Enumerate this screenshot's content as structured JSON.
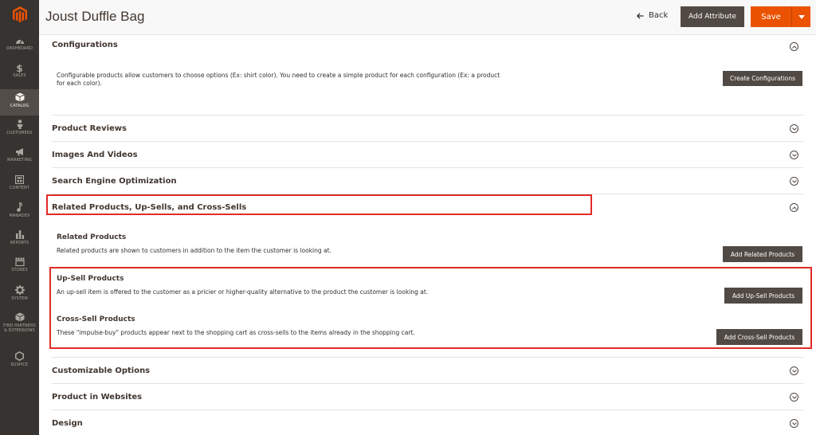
{
  "header": {
    "title": "Joust Duffle Bag",
    "back_label": "Back",
    "add_attribute_label": "Add Attribute",
    "save_label": "Save"
  },
  "sidebar": {
    "items": [
      {
        "label": "DASHBOARD",
        "icon": "dashboard-icon"
      },
      {
        "label": "SALES",
        "icon": "dollar-icon"
      },
      {
        "label": "CATALOG",
        "icon": "cube-icon"
      },
      {
        "label": "CUSTOMERS",
        "icon": "person-icon"
      },
      {
        "label": "MARKETING",
        "icon": "megaphone-icon"
      },
      {
        "label": "CONTENT",
        "icon": "content-icon"
      },
      {
        "label": "MANADEV",
        "icon": "manadev-icon"
      },
      {
        "label": "REPORTS",
        "icon": "bar-chart-icon"
      },
      {
        "label": "STORES",
        "icon": "store-icon"
      },
      {
        "label": "SYSTEM",
        "icon": "gear-icon"
      },
      {
        "label": "FIND PARTNERS & EXTENSIONS",
        "icon": "partners-icon"
      },
      {
        "label": "B2SPICE",
        "icon": "hexagon-icon"
      }
    ]
  },
  "sections": {
    "configurations": {
      "title": "Configurations",
      "description": "Configurable products allow customers to choose options (Ex: shirt color). You need to create a simple product for each configuration (Ex: a product for each color).",
      "button": "Create Configurations"
    },
    "product_reviews": {
      "title": "Product Reviews"
    },
    "images_videos": {
      "title": "Images And Videos"
    },
    "seo": {
      "title": "Search Engine Optimization"
    },
    "related": {
      "title": "Related Products, Up-Sells, and Cross-Sells",
      "related_title": "Related Products",
      "related_desc": "Related products are shown to customers in addition to the item the customer is looking at.",
      "related_button": "Add Related Products",
      "upsell_title": "Up-Sell Products",
      "upsell_desc": "An up-sell item is offered to the customer as a pricier or higher-quality alternative to the product the customer is looking at.",
      "upsell_button": "Add Up-Sell Products",
      "crosssell_title": "Cross-Sell Products",
      "crosssell_desc": "These \"impulse-buy\" products appear next to the shopping cart as cross-sells to the items already in the shopping cart.",
      "crosssell_button": "Add Cross-Sell Products"
    },
    "customizable_options": {
      "title": "Customizable Options"
    },
    "product_in_websites": {
      "title": "Product in Websites"
    },
    "design": {
      "title": "Design"
    }
  },
  "colors": {
    "sidebar_bg": "#373330",
    "primary_button": "#514943",
    "save_button": "#eb5202",
    "highlight_red": "#e02b27"
  }
}
